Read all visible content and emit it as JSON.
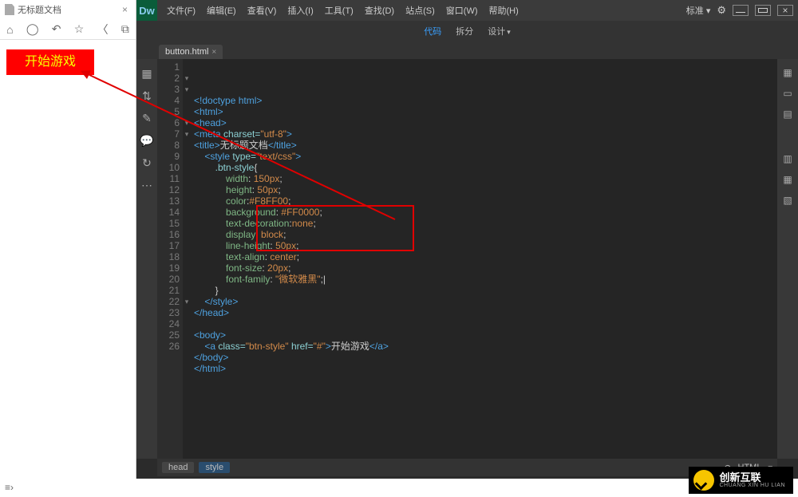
{
  "browser": {
    "tab_title": "无标题文档",
    "button_text": "开始游戏"
  },
  "dw": {
    "logo": "Dw",
    "menu": [
      "文件(F)",
      "编辑(E)",
      "查看(V)",
      "插入(I)",
      "工具(T)",
      "查找(D)",
      "站点(S)",
      "窗口(W)",
      "帮助(H)"
    ],
    "workspace": "标准 ▾",
    "view": {
      "code": "代码",
      "split": "拆分",
      "design": "设计"
    },
    "doc_tab": "button.html",
    "status": {
      "head": "head",
      "style": "style",
      "lang": "HTML"
    },
    "code_lines": [
      {
        "n": 1,
        "f": "",
        "html": "<span class='c-tag'>&lt;!doctype html&gt;</span>"
      },
      {
        "n": 2,
        "f": "▾",
        "html": "<span class='c-tag'>&lt;html&gt;</span>"
      },
      {
        "n": 3,
        "f": "▾",
        "html": "<span class='c-tag'>&lt;head&gt;</span>"
      },
      {
        "n": 4,
        "f": "",
        "html": "<span class='c-tag'>&lt;meta</span> <span class='c-attr'>charset=</span><span class='c-str'>\"utf-8\"</span><span class='c-tag'>&gt;</span>"
      },
      {
        "n": 5,
        "f": "",
        "html": "<span class='c-tag'>&lt;title&gt;</span><span class='c-text'>无标题文档</span><span class='c-tag'>&lt;/title&gt;</span>"
      },
      {
        "n": 6,
        "f": "▾",
        "html": "    <span class='c-tag'>&lt;style</span> <span class='c-attr'>type=</span><span class='c-str'>\"text/css\"</span><span class='c-tag'>&gt;</span>"
      },
      {
        "n": 7,
        "f": "▾",
        "html": "        <span class='c-attr'>.btn-style</span><span class='c-punc'>{</span>"
      },
      {
        "n": 8,
        "f": "",
        "html": "            <span class='c-prop'>width</span><span class='c-punc'>: </span><span class='c-str'>150px</span><span class='c-punc'>;</span>"
      },
      {
        "n": 9,
        "f": "",
        "html": "            <span class='c-prop'>height</span><span class='c-punc'>: </span><span class='c-str'>50px</span><span class='c-punc'>;</span>"
      },
      {
        "n": 10,
        "f": "",
        "html": "            <span class='c-prop'>color</span><span class='c-punc'>:</span><span class='c-str'>#F8FF00</span><span class='c-punc'>;</span>"
      },
      {
        "n": 11,
        "f": "",
        "html": "            <span class='c-prop'>background</span><span class='c-punc'>: </span><span class='c-str'>#FF0000</span><span class='c-punc'>;</span>"
      },
      {
        "n": 12,
        "f": "",
        "html": "            <span class='c-prop'>text-decoration</span><span class='c-punc'>:</span><span class='c-str'>none</span><span class='c-punc'>;</span>"
      },
      {
        "n": 13,
        "f": "",
        "html": "            <span class='c-prop'>display</span><span class='c-punc'>: </span><span class='c-str'>block</span><span class='c-punc'>;</span>"
      },
      {
        "n": 14,
        "f": "",
        "html": "            <span class='c-prop'>line-height</span><span class='c-punc'>: </span><span class='c-str'>50px</span><span class='c-punc'>;</span>"
      },
      {
        "n": 15,
        "f": "",
        "html": "            <span class='c-prop'>text-align</span><span class='c-punc'>: </span><span class='c-str'>center</span><span class='c-punc'>;</span>"
      },
      {
        "n": 16,
        "f": "",
        "html": "            <span class='c-prop'>font-size</span><span class='c-punc'>: </span><span class='c-str'>20px</span><span class='c-punc'>;</span>"
      },
      {
        "n": 17,
        "f": "",
        "html": "            <span class='c-prop'>font-family</span><span class='c-punc'>: </span><span class='c-str'>\"微软雅黑\"</span><span class='c-punc'>;</span><span class='c-punc'>|</span>"
      },
      {
        "n": 18,
        "f": "",
        "html": "        <span class='c-punc'>}</span>"
      },
      {
        "n": 19,
        "f": "",
        "html": "    <span class='c-tag'>&lt;/style&gt;</span>"
      },
      {
        "n": 20,
        "f": "",
        "html": "<span class='c-tag'>&lt;/head&gt;</span>"
      },
      {
        "n": 21,
        "f": "",
        "html": ""
      },
      {
        "n": 22,
        "f": "▾",
        "html": "<span class='c-tag'>&lt;body&gt;</span>"
      },
      {
        "n": 23,
        "f": "",
        "html": "    <span class='c-tag'>&lt;a</span> <span class='c-attr'>class=</span><span class='c-str'>\"btn-style\"</span> <span class='c-attr'>href=</span><span class='c-str'>\"#\"</span><span class='c-tag'>&gt;</span><span class='c-text'>开始游戏</span><span class='c-tag'>&lt;/a&gt;</span>"
      },
      {
        "n": 24,
        "f": "",
        "html": "<span class='c-tag'>&lt;/body&gt;</span>"
      },
      {
        "n": 25,
        "f": "",
        "html": "<span class='c-tag'>&lt;/html&gt;</span>"
      },
      {
        "n": 26,
        "f": "",
        "html": ""
      }
    ]
  },
  "brand": {
    "main": "创新互联",
    "sub": "CHUANG XIN HU LIAN"
  }
}
